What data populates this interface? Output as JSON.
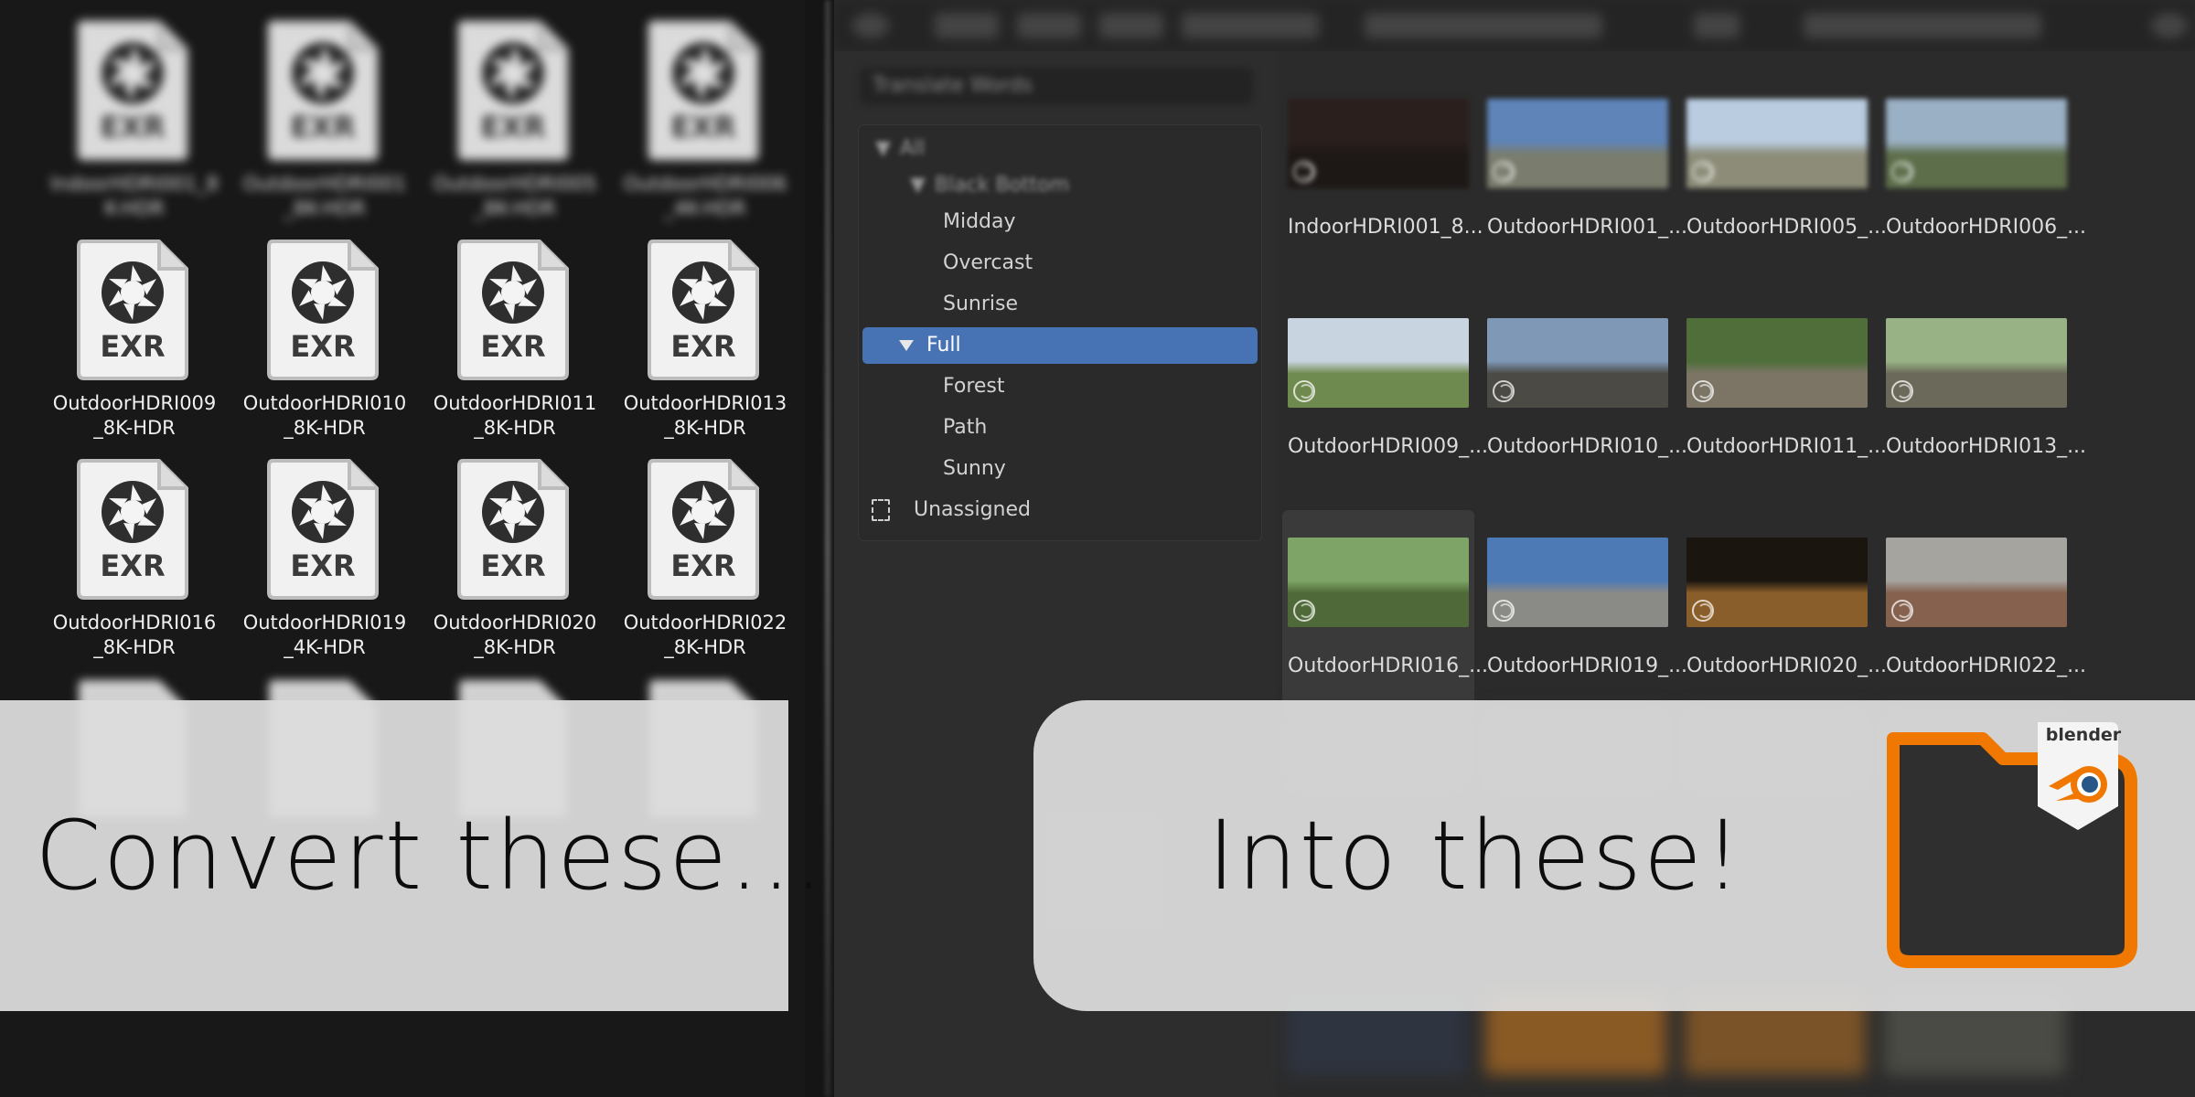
{
  "explorer": {
    "files": [
      {
        "ext": "EXR",
        "name": "IndoorHDRI001_8\nK-HDR",
        "blurred": true
      },
      {
        "ext": "EXR",
        "name": "OutdoorHDRI001\n_8K-HDR",
        "blurred": true
      },
      {
        "ext": "EXR",
        "name": "OutdoorHDRI005\n_8K-HDR",
        "blurred": true
      },
      {
        "ext": "EXR",
        "name": "OutdoorHDRI006\n_4K-HDR",
        "blurred": true
      },
      {
        "ext": "EXR",
        "name": "OutdoorHDRI009\n_8K-HDR",
        "blurred": false
      },
      {
        "ext": "EXR",
        "name": "OutdoorHDRI010\n_8K-HDR",
        "blurred": false
      },
      {
        "ext": "EXR",
        "name": "OutdoorHDRI011\n_8K-HDR",
        "blurred": false
      },
      {
        "ext": "EXR",
        "name": "OutdoorHDRI013\n_8K-HDR",
        "blurred": false
      },
      {
        "ext": "EXR",
        "name": "OutdoorHDRI016\n_8K-HDR",
        "blurred": false
      },
      {
        "ext": "EXR",
        "name": "OutdoorHDRI019\n_4K-HDR",
        "blurred": false
      },
      {
        "ext": "EXR",
        "name": "OutdoorHDRI020\n_8K-HDR",
        "blurred": false
      },
      {
        "ext": "EXR",
        "name": "OutdoorHDRI022\n_8K-HDR",
        "blurred": false
      }
    ]
  },
  "asset_browser": {
    "filter_placeholder": "Translate Words",
    "catalog": {
      "root": "All",
      "group": "Black Bottom",
      "items": [
        {
          "label": "Midday",
          "level": "child"
        },
        {
          "label": "Overcast",
          "level": "child"
        },
        {
          "label": "Sunrise",
          "level": "child"
        },
        {
          "label": "Full",
          "level": "parent",
          "selected": true
        },
        {
          "label": "Forest",
          "level": "child"
        },
        {
          "label": "Path",
          "level": "child"
        },
        {
          "label": "Sunny",
          "level": "child"
        },
        {
          "label": "Unassigned",
          "level": "root"
        }
      ]
    },
    "assets": [
      {
        "name": "IndoorHDRI001_8...",
        "sky": "#2a1f1d",
        "ground": "#1d1816",
        "hover": false
      },
      {
        "name": "OutdoorHDRI001_...",
        "sky": "#5e84b8",
        "ground": "#7a7d6e",
        "hover": false
      },
      {
        "name": "OutdoorHDRI005_...",
        "sky": "#b9cce0",
        "ground": "#8c8c78",
        "hover": false
      },
      {
        "name": "OutdoorHDRI006_...",
        "sky": "#9ab0c4",
        "ground": "#5d6e4a",
        "hover": false
      },
      {
        "name": "OutdoorHDRI009_...",
        "sky": "#c8d4df",
        "ground": "#6f8a4e",
        "hover": false
      },
      {
        "name": "OutdoorHDRI010_...",
        "sky": "#7e98b6",
        "ground": "#4b4a45",
        "hover": false
      },
      {
        "name": "OutdoorHDRI011_...",
        "sky": "#4f6e3a",
        "ground": "#7c7566",
        "hover": false
      },
      {
        "name": "OutdoorHDRI013_...",
        "sky": "#98b285",
        "ground": "#6b6a5a",
        "hover": false
      },
      {
        "name": "OutdoorHDRI016_...",
        "sky": "#7ea567",
        "ground": "#4f6a38",
        "hover": true
      },
      {
        "name": "OutdoorHDRI019_...",
        "sky": "#4d79b5",
        "ground": "#8a8a87",
        "hover": false
      },
      {
        "name": "OutdoorHDRI020_...",
        "sky": "#1a150f",
        "ground": "#8a5e2a",
        "hover": false
      },
      {
        "name": "OutdoorHDRI022_...",
        "sky": "#a5a49e",
        "ground": "#85614e",
        "hover": false
      }
    ]
  },
  "overlay": {
    "left_text": "Convert these...",
    "right_text": "Into these!",
    "logo_text": "blender"
  },
  "colors": {
    "selection": "#4772b3",
    "logo_orange": "#f07800",
    "logo_blue": "#265787"
  }
}
